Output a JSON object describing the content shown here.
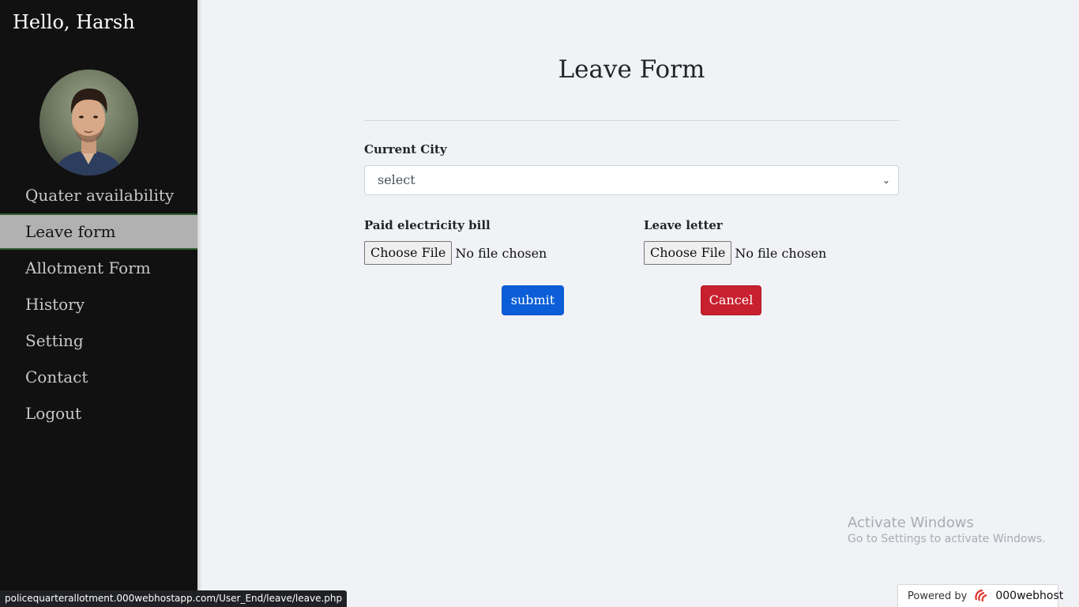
{
  "sidebar": {
    "greeting": "Hello, Harsh",
    "items": [
      {
        "label": "Quater availability"
      },
      {
        "label": "Leave form"
      },
      {
        "label": "Allotment Form"
      },
      {
        "label": "History"
      },
      {
        "label": "Setting"
      },
      {
        "label": "Contact"
      },
      {
        "label": "Logout"
      }
    ],
    "active_item": "Leave form"
  },
  "form": {
    "title": "Leave Form",
    "city": {
      "label": "Current City",
      "value": "select"
    },
    "bill": {
      "label": "Paid electricity bill",
      "button": "Choose File",
      "status": "No file chosen"
    },
    "letter": {
      "label": "Leave letter",
      "button": "Choose File",
      "status": "No file chosen"
    },
    "submit_label": "submit",
    "cancel_label": "Cancel"
  },
  "watermark": {
    "line1": "Activate Windows",
    "line2": "Go to Settings to activate Windows."
  },
  "status_bar": {
    "url": "policequarterallotment.000webhostapp.com/User_End/leave/leave.php"
  },
  "powered_by": {
    "prefix": "Powered by",
    "brand": "000webhost"
  },
  "colors": {
    "sidebar_bg": "#111111",
    "active_item_bg": "#b1b1b1",
    "submit": "#0b5ed7",
    "cancel": "#c8202f",
    "page_bg": "#f1f2f6"
  }
}
